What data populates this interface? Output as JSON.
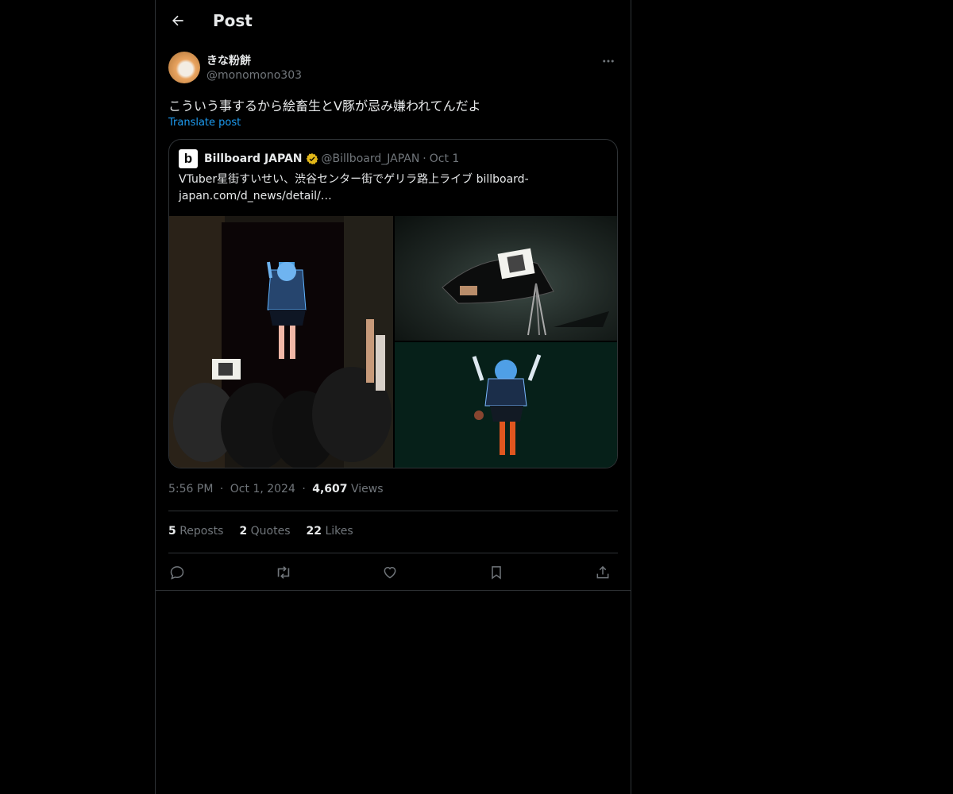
{
  "header": {
    "title": "Post"
  },
  "author": {
    "name": "きな粉餅",
    "handle": "@monomono303"
  },
  "post": {
    "text": "こういう事するから絵畜生とV豚が忌み嫌われてんだよ",
    "translate_label": "Translate post"
  },
  "quote": {
    "name": "Billboard JAPAN",
    "handle": "@Billboard_JAPAN",
    "separator": "·",
    "date": "Oct 1",
    "text": "VTuber星街すいせい、渋谷センター街でゲリラ路上ライブ billboard-japan.com/d_news/detail/…",
    "logo_letter": "b"
  },
  "meta": {
    "time": "5:56 PM",
    "sep1": "·",
    "date": "Oct 1, 2024",
    "sep2": "·",
    "views_count": "4,607",
    "views_label": "Views"
  },
  "stats": {
    "reposts_count": "5",
    "reposts_label": "Reposts",
    "quotes_count": "2",
    "quotes_label": "Quotes",
    "likes_count": "22",
    "likes_label": "Likes"
  },
  "colors": {
    "background": "#000000",
    "text": "#e7e9ea",
    "muted": "#71767b",
    "link": "#1d9bf0",
    "border": "#2f3336",
    "verified": "#e2b719"
  },
  "icons": [
    "arrow-left-icon",
    "more-icon",
    "verified-badge-icon",
    "reply-icon",
    "repost-icon",
    "like-icon",
    "bookmark-icon",
    "share-icon"
  ]
}
